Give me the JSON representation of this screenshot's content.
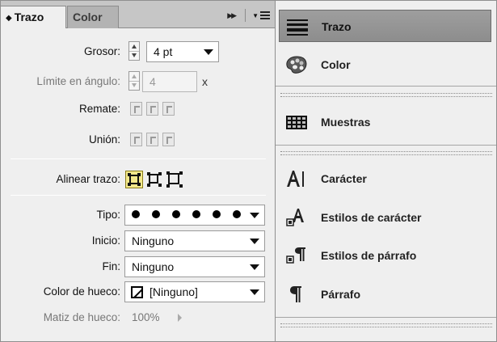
{
  "stroke_panel": {
    "tabs": [
      {
        "label": "Trazo",
        "active": true
      },
      {
        "label": "Color",
        "active": false
      }
    ],
    "weight": {
      "label": "Grosor:",
      "value": "4 pt"
    },
    "miter_limit": {
      "label": "Límite en ángulo:",
      "value": "4",
      "suffix": "x"
    },
    "cap": {
      "label": "Remate:"
    },
    "join": {
      "label": "Unión:"
    },
    "align_stroke": {
      "label": "Alinear trazo:"
    },
    "type": {
      "label": "Tipo:"
    },
    "start": {
      "label": "Inicio:",
      "value": "Ninguno"
    },
    "end": {
      "label": "Fin:",
      "value": "Ninguno"
    },
    "gap_color": {
      "label": "Color de hueco:",
      "value": "[Ninguno]"
    },
    "gap_tint": {
      "label": "Matiz de hueco:",
      "value": "100%"
    }
  },
  "dock": {
    "items": [
      {
        "label": "Trazo",
        "icon": "stroke-icon",
        "active": true
      },
      {
        "label": "Color",
        "icon": "color-palette-icon",
        "active": false
      },
      {
        "label": "Muestras",
        "icon": "swatches-grid-icon",
        "active": false
      },
      {
        "label": "Carácter",
        "icon": "character-icon",
        "active": false
      },
      {
        "label": "Estilos de carácter",
        "icon": "character-styles-icon",
        "active": false
      },
      {
        "label": "Estilos de párrafo",
        "icon": "paragraph-styles-icon",
        "active": false
      },
      {
        "label": "Párrafo",
        "icon": "paragraph-icon",
        "active": false
      }
    ]
  },
  "colors": {
    "panel_bg": "#efefef",
    "tabbar_bg": "#c6c6c6",
    "active_dock_item": "#959595",
    "selected_align_button": "#f3e88b"
  }
}
